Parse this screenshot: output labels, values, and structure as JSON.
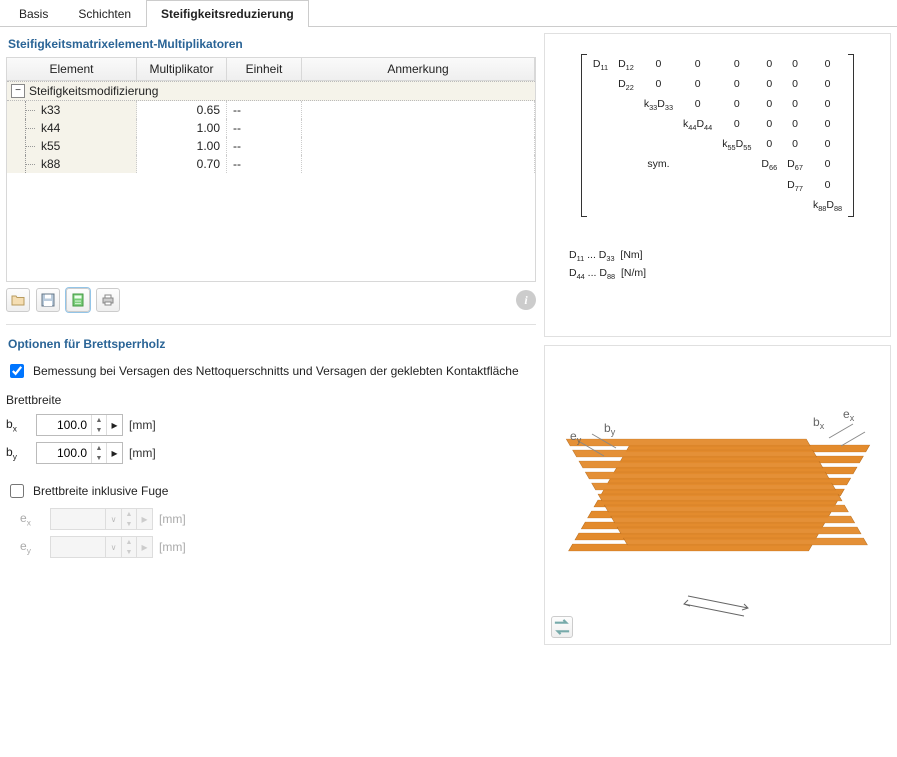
{
  "tabs": [
    "Basis",
    "Schichten",
    "Steifigkeitsreduzierung"
  ],
  "active_tab": "Steifigkeitsreduzierung",
  "multiplier_panel": {
    "title": "Steifigkeitsmatrixelement-Multiplikatoren",
    "columns": [
      "Element",
      "Multiplikator",
      "Einheit",
      "Anmerkung"
    ],
    "group_label": "Steifigkeitsmodifizierung",
    "rows": [
      {
        "element": "k33",
        "mult": "0.65",
        "unit": "--",
        "note": ""
      },
      {
        "element": "k44",
        "mult": "1.00",
        "unit": "--",
        "note": ""
      },
      {
        "element": "k55",
        "mult": "1.00",
        "unit": "--",
        "note": ""
      },
      {
        "element": "k88",
        "mult": "0.70",
        "unit": "--",
        "note": ""
      }
    ]
  },
  "options_panel": {
    "title": "Optionen für Brettsperrholz",
    "checkbox1_label": "Bemessung bei Versagen des Nettoquerschnitts und Versagen der geklebten Kontaktfläche",
    "board_width_label": "Brettbreite",
    "bx_label": "bx",
    "by_label": "by",
    "bx_value": "100.0",
    "by_value": "100.0",
    "unit_mm": "[mm]",
    "checkbox2_label": "Brettbreite inklusive Fuge",
    "ex_label": "ex",
    "ey_label": "ey"
  },
  "matrix_notes": {
    "line1": "D11 ... D33  [Nm]",
    "line2": "D44 ... D88  [N/m]"
  },
  "icons": {
    "folder": "folder",
    "floppy": "floppy",
    "calculator": "calculator",
    "printer": "printer",
    "info": "info",
    "swap": "swap"
  }
}
